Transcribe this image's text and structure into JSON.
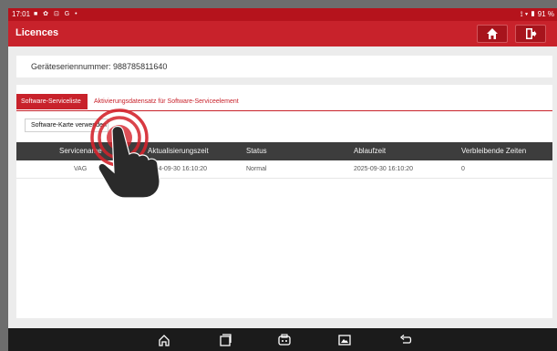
{
  "status_bar": {
    "time": "17:01",
    "icons": "■ ✿ ⊡ G •",
    "battery": "91 %"
  },
  "app": {
    "title": "Licences",
    "home_icon": "home-icon",
    "exit_icon": "exit-icon"
  },
  "device": {
    "serial_label": "Geräteseriennummer: 988785811640"
  },
  "tabs": [
    {
      "label": "Software-Serviceliste",
      "active": true
    },
    {
      "label": "Aktivierungsdatensatz für Software-Serviceelement",
      "active": false
    }
  ],
  "actions": {
    "software_button": "Software-Karte verwenden"
  },
  "table": {
    "columns": [
      "Servicename",
      "Aktualisierungszeit",
      "Status",
      "Ablaufzeit",
      "Verbleibende Zeiten"
    ],
    "rows": [
      [
        "VAG",
        "2024-09-30 16:10:20",
        "Normal",
        "2025-09-30 16:10:20",
        "0"
      ]
    ]
  },
  "navbar": {
    "icons": [
      "home-icon",
      "recent-apps-icon",
      "vci-icon",
      "screenshot-icon",
      "back-icon"
    ]
  },
  "colors": {
    "brand_red": "#c8222b",
    "header_dark": "#3d3d3d"
  }
}
